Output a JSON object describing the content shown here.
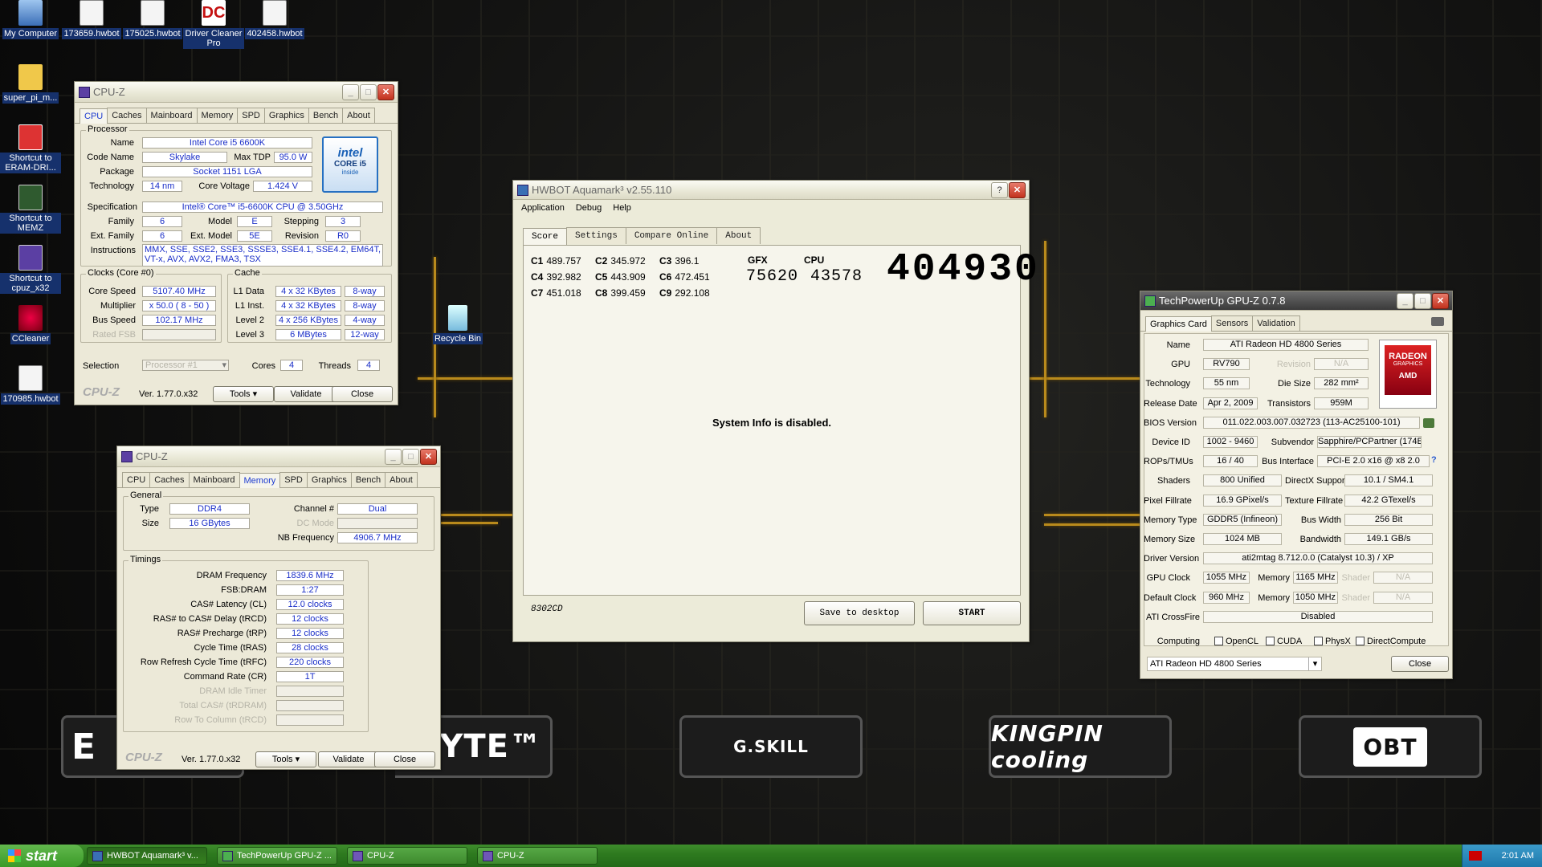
{
  "desktop": {
    "icons": [
      {
        "label": "My Computer",
        "icon": "computer-icon"
      },
      {
        "label": "173659.hwbot",
        "icon": "file-icon"
      },
      {
        "label": "175025.hwbot",
        "icon": "file-icon"
      },
      {
        "label": "Driver Cleaner Pro",
        "icon": "driver-cleaner-icon"
      },
      {
        "label": "402458.hwbot",
        "icon": "file-icon"
      },
      {
        "label": "super_pi_m...",
        "icon": "folder-icon"
      },
      {
        "label": "Shortcut to ERAM-DRI...",
        "icon": "shortcut-icon"
      },
      {
        "label": "Shortcut to MEMZ",
        "icon": "shortcut-icon"
      },
      {
        "label": "Shortcut to cpuz_x32",
        "icon": "shortcut-icon"
      },
      {
        "label": "CCleaner",
        "icon": "ccleaner-icon"
      },
      {
        "label": "170985.hwbot",
        "icon": "file-icon"
      },
      {
        "label": "Recycle Bin",
        "icon": "recycle-bin-icon"
      }
    ],
    "sponsor_logos": [
      "E",
      "ABYTE™",
      "G.SKILL",
      "KINGPIN cooling",
      "OBT"
    ]
  },
  "cpuz1": {
    "title": "CPU-Z",
    "tabs": [
      "CPU",
      "Caches",
      "Mainboard",
      "Memory",
      "SPD",
      "Graphics",
      "Bench",
      "About"
    ],
    "processor_group": "Processor",
    "labels": {
      "name": "Name",
      "codename": "Code Name",
      "maxtdp": "Max TDP",
      "package": "Package",
      "technology": "Technology",
      "corevoltage": "Core Voltage",
      "spec": "Specification",
      "family": "Family",
      "model": "Model",
      "stepping": "Stepping",
      "extfamily": "Ext. Family",
      "extmodel": "Ext. Model",
      "revision": "Revision",
      "instructions": "Instructions"
    },
    "values": {
      "name": "Intel Core i5 6600K",
      "codename": "Skylake",
      "maxtdp": "95.0 W",
      "package": "Socket 1151 LGA",
      "technology": "14 nm",
      "corevoltage": "1.424 V",
      "spec": "Intel® Core™ i5-6600K CPU @ 3.50GHz",
      "family": "6",
      "model": "E",
      "stepping": "3",
      "extfamily": "6",
      "extmodel": "5E",
      "revision": "R0",
      "instructions": "MMX, SSE, SSE2, SSE3, SSSE3, SSE4.1, SSE4.2, EM64T, VT-x, AVX, AVX2, FMA3, TSX"
    },
    "intel_badge": {
      "line1": "intel",
      "line2": "CORE i5",
      "line3": "inside"
    },
    "clocks_group": "Clocks (Core #0)",
    "clock_labels": {
      "core_speed": "Core Speed",
      "multiplier": "Multiplier",
      "bus_speed": "Bus Speed",
      "rated_fsb": "Rated FSB"
    },
    "clock_values": {
      "core_speed": "5107.40 MHz",
      "multiplier": "x 50.0 ( 8 - 50 )",
      "bus_speed": "102.17 MHz",
      "rated_fsb": ""
    },
    "cache_group": "Cache",
    "cache_rows": [
      {
        "label": "L1 Data",
        "size": "4 x 32 KBytes",
        "way": "8-way"
      },
      {
        "label": "L1 Inst.",
        "size": "4 x 32 KBytes",
        "way": "8-way"
      },
      {
        "label": "Level 2",
        "size": "4 x 256 KBytes",
        "way": "4-way"
      },
      {
        "label": "Level 3",
        "size": "6 MBytes",
        "way": "12-way"
      }
    ],
    "selection_label": "Selection",
    "selection_value": "Processor #1",
    "cores_label": "Cores",
    "cores_value": "4",
    "threads_label": "Threads",
    "threads_value": "4",
    "footer": {
      "logo": "CPU-Z",
      "version": "Ver. 1.77.0.x32",
      "tools": "Tools",
      "validate": "Validate",
      "close": "Close"
    }
  },
  "cpuz2": {
    "title": "CPU-Z",
    "tabs": [
      "CPU",
      "Caches",
      "Mainboard",
      "Memory",
      "SPD",
      "Graphics",
      "Bench",
      "About"
    ],
    "general_group": "General",
    "type_label": "Type",
    "type_value": "DDR4",
    "size_label": "Size",
    "size_value": "16 GBytes",
    "channel_label": "Channel #",
    "channel_value": "Dual",
    "dcmode_label": "DC Mode",
    "dcmode_value": "",
    "nbfreq_label": "NB Frequency",
    "nbfreq_value": "4906.7 MHz",
    "timings_group": "Timings",
    "timings": [
      {
        "label": "DRAM Frequency",
        "value": "1839.6 MHz",
        "disabled": false
      },
      {
        "label": "FSB:DRAM",
        "value": "1:27",
        "disabled": false
      },
      {
        "label": "CAS# Latency (CL)",
        "value": "12.0 clocks",
        "disabled": false
      },
      {
        "label": "RAS# to CAS# Delay (tRCD)",
        "value": "12 clocks",
        "disabled": false
      },
      {
        "label": "RAS# Precharge (tRP)",
        "value": "12 clocks",
        "disabled": false
      },
      {
        "label": "Cycle Time (tRAS)",
        "value": "28 clocks",
        "disabled": false
      },
      {
        "label": "Row Refresh Cycle Time (tRFC)",
        "value": "220 clocks",
        "disabled": false
      },
      {
        "label": "Command Rate (CR)",
        "value": "1T",
        "disabled": false
      },
      {
        "label": "DRAM Idle Timer",
        "value": "",
        "disabled": true
      },
      {
        "label": "Total CAS# (tRDRAM)",
        "value": "",
        "disabled": true
      },
      {
        "label": "Row To Column (tRCD)",
        "value": "",
        "disabled": true
      }
    ],
    "footer": {
      "logo": "CPU-Z",
      "version": "Ver. 1.77.0.x32",
      "tools": "Tools",
      "validate": "Validate",
      "close": "Close"
    }
  },
  "aquamark": {
    "title": "HWBOT Aquamark³ v2.55.110",
    "menu": [
      "Application",
      "Debug",
      "Help"
    ],
    "tabs": [
      "Score",
      "Settings",
      "Compare Online",
      "About"
    ],
    "scores": [
      {
        "k": "C1",
        "v": "489.757"
      },
      {
        "k": "C4",
        "v": "392.982"
      },
      {
        "k": "C7",
        "v": "451.018"
      },
      {
        "k": "C2",
        "v": "345.972"
      },
      {
        "k": "C5",
        "v": "443.909"
      },
      {
        "k": "C8",
        "v": "399.459"
      },
      {
        "k": "C3",
        "v": "396.1"
      },
      {
        "k": "C6",
        "v": "472.451"
      },
      {
        "k": "C9",
        "v": "292.108"
      }
    ],
    "gfx_label": "GFX",
    "gfx_value": "75620",
    "cpu_label": "CPU",
    "cpu_value": "43578",
    "total": "404930",
    "sysinfo": "System Info is disabled.",
    "code": "8302CD",
    "save_btn": "Save to desktop",
    "start_btn": "START"
  },
  "gpuz": {
    "title": "TechPowerUp GPU-Z 0.7.8",
    "tabs": [
      "Graphics Card",
      "Sensors",
      "Validation"
    ],
    "rows": {
      "name": {
        "l": "Name",
        "v": "ATI Radeon HD 4800 Series"
      },
      "gpu": {
        "l": "GPU",
        "v": "RV790"
      },
      "revision": {
        "l": "Revision",
        "v": "N/A"
      },
      "technology": {
        "l": "Technology",
        "v": "55 nm"
      },
      "diesize": {
        "l": "Die Size",
        "v": "282 mm²"
      },
      "release": {
        "l": "Release Date",
        "v": "Apr 2, 2009"
      },
      "transistors": {
        "l": "Transistors",
        "v": "959M"
      },
      "bios": {
        "l": "BIOS Version",
        "v": "011.022.003.007.032723 (113-AC25100-101)"
      },
      "deviceid": {
        "l": "Device ID",
        "v": "1002 - 9460"
      },
      "subvendor": {
        "l": "Subvendor",
        "v": "Sapphire/PCPartner (174B)"
      },
      "rops": {
        "l": "ROPs/TMUs",
        "v": "16 / 40"
      },
      "busif": {
        "l": "Bus Interface",
        "v": "PCI-E 2.0 x16 @ x8 2.0"
      },
      "shaders": {
        "l": "Shaders",
        "v": "800 Unified"
      },
      "directx": {
        "l": "DirectX Support",
        "v": "10.1 / SM4.1"
      },
      "pixel": {
        "l": "Pixel Fillrate",
        "v": "16.9 GPixel/s"
      },
      "texture": {
        "l": "Texture Fillrate",
        "v": "42.2 GTexel/s"
      },
      "memtype": {
        "l": "Memory Type",
        "v": "GDDR5 (Infineon)"
      },
      "buswidth": {
        "l": "Bus Width",
        "v": "256 Bit"
      },
      "memsize": {
        "l": "Memory Size",
        "v": "1024 MB"
      },
      "bandwidth": {
        "l": "Bandwidth",
        "v": "149.1 GB/s"
      },
      "driver": {
        "l": "Driver Version",
        "v": "ati2mtag 8.712.0.0 (Catalyst 10.3) / XP"
      },
      "gpuclock": {
        "l": "GPU Clock",
        "v": "1055 MHz"
      },
      "memory1": {
        "l": "Memory",
        "v": "1165 MHz"
      },
      "shader1": {
        "l": "Shader",
        "v": "N/A"
      },
      "defclock": {
        "l": "Default Clock",
        "v": "960 MHz"
      },
      "memory2": {
        "l": "Memory",
        "v": "1050 MHz"
      },
      "shader2": {
        "l": "Shader",
        "v": "N/A"
      },
      "crossfire": {
        "l": "ATI CrossFire",
        "v": "Disabled"
      }
    },
    "computing_label": "Computing",
    "computing": [
      "OpenCL",
      "CUDA",
      "PhysX",
      "DirectCompute"
    ],
    "select_value": "ATI Radeon HD 4800 Series",
    "close": "Close",
    "badge": {
      "line1": "RADEON",
      "line2": "GRAPHICS",
      "line3": "AMD"
    }
  },
  "taskbar": {
    "start": "start",
    "items": [
      {
        "label": "HWBOT Aquamark³ v...",
        "active": true
      },
      {
        "label": "TechPowerUp GPU-Z ...",
        "active": false
      },
      {
        "label": "CPU-Z",
        "active": false
      },
      {
        "label": "CPU-Z",
        "active": false
      }
    ],
    "clock": "2:01 AM"
  }
}
